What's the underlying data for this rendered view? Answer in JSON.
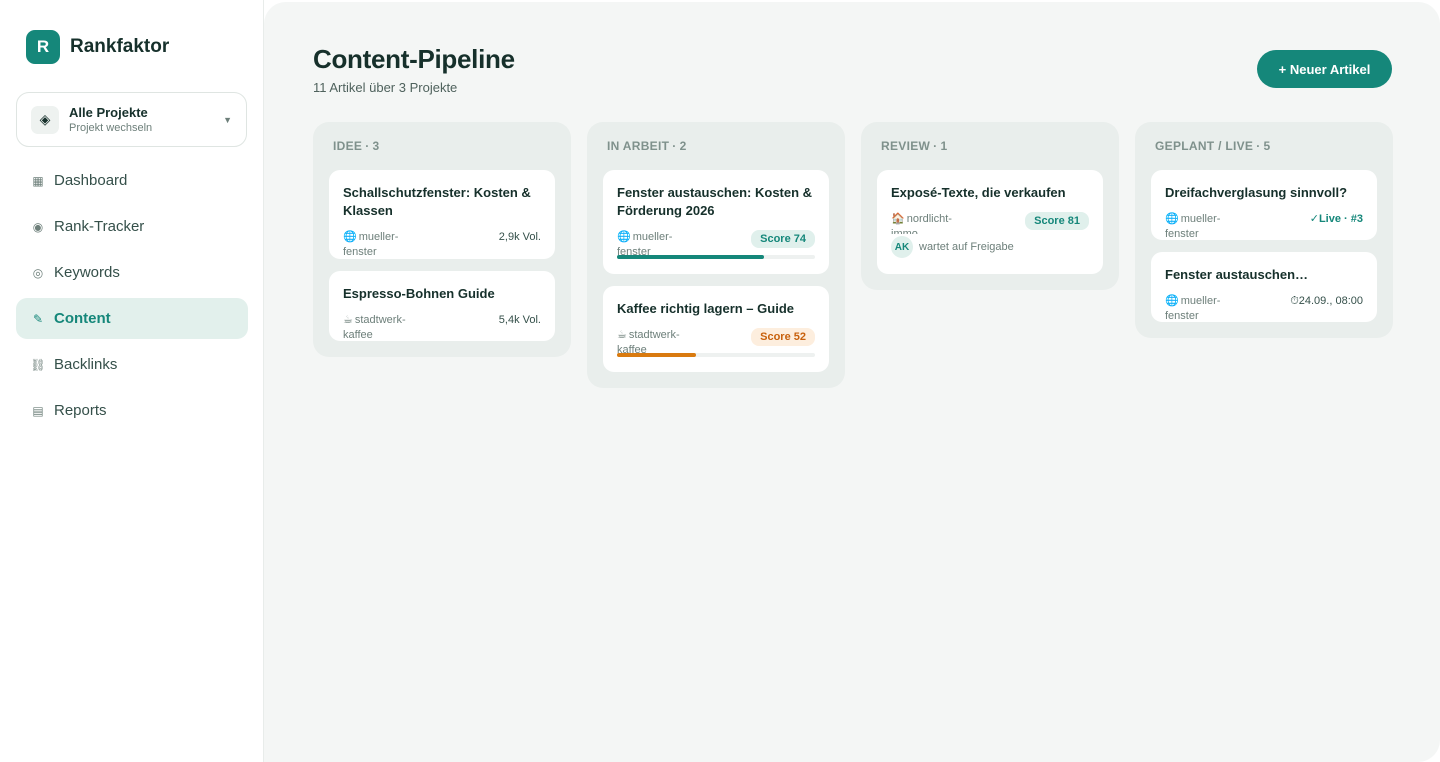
{
  "brand": {
    "logo_letter": "R",
    "name": "Rankfaktor"
  },
  "project_switcher": {
    "icon": "diamond-icon",
    "title": "Alle Projekte",
    "subtitle": "Projekt wechseln"
  },
  "nav": [
    {
      "label": "Dashboard",
      "icon": "grid-icon",
      "glyph": "▦",
      "active": false
    },
    {
      "label": "Rank-Tracker",
      "icon": "target-icon",
      "glyph": "◉",
      "active": false
    },
    {
      "label": "Keywords",
      "icon": "circle-icon",
      "glyph": "◎",
      "active": false
    },
    {
      "label": "Content",
      "icon": "pen-icon",
      "glyph": "✎",
      "active": true
    },
    {
      "label": "Backlinks",
      "icon": "link-icon",
      "glyph": "⛓",
      "active": false
    },
    {
      "label": "Reports",
      "icon": "report-icon",
      "glyph": "▤",
      "active": false
    }
  ],
  "header": {
    "title": "Content-Pipeline",
    "subtitle": "11 Artikel über 3 Projekte",
    "new_button": "+ Neuer Artikel"
  },
  "columns": [
    {
      "name": "IDEE",
      "count": "3",
      "cards": [
        {
          "title": "Schallschutzfenster: Kosten & Klassen",
          "project_emoji": "🌐",
          "project": "mueller-fenster",
          "volume": "2,9k Vol."
        },
        {
          "title": "Espresso-Bohnen Guide",
          "project_emoji": "☕",
          "project": "stadtwerk-kaffee",
          "volume": "5,4k Vol."
        }
      ]
    },
    {
      "name": "IN ARBEIT",
      "count": "2",
      "cards": [
        {
          "title": "Fenster austauschen: Kosten & Förderung 2026",
          "project_emoji": "🌐",
          "project": "mueller-fenster",
          "score": "Score 74",
          "score_color": "green",
          "progress": 0.74
        },
        {
          "title": "Kaffee richtig lagern – Guide",
          "project_emoji": "☕",
          "project": "stadtwerk-kaffee",
          "score": "Score 52",
          "score_color": "orange",
          "progress": 0.4
        }
      ]
    },
    {
      "name": "REVIEW",
      "count": "1",
      "cards": [
        {
          "title": "Exposé-Texte, die verkaufen",
          "project_emoji": "🏠",
          "project": "nordlicht-immo",
          "score": "Score 81",
          "score_color": "green",
          "assignee_initials": "AK",
          "assignee_status": "wartet auf Freigabe"
        }
      ]
    },
    {
      "name": "GEPLANT / LIVE",
      "count": "5",
      "cards": [
        {
          "title": "Dreifachverglasung sinnvoll?",
          "project_emoji": "🌐",
          "project": "mueller-fenster",
          "status": "✓Live · #3"
        },
        {
          "title": "Fenster austauschen…",
          "project_emoji": "🌐",
          "project": "mueller-fenster",
          "date": "⏱24.09., 08:00"
        }
      ]
    }
  ],
  "colors": {
    "accent": "#15877a",
    "accent_light": "#e2f0ec",
    "warning": "#d97a0f",
    "background": "#f4f6f5"
  }
}
